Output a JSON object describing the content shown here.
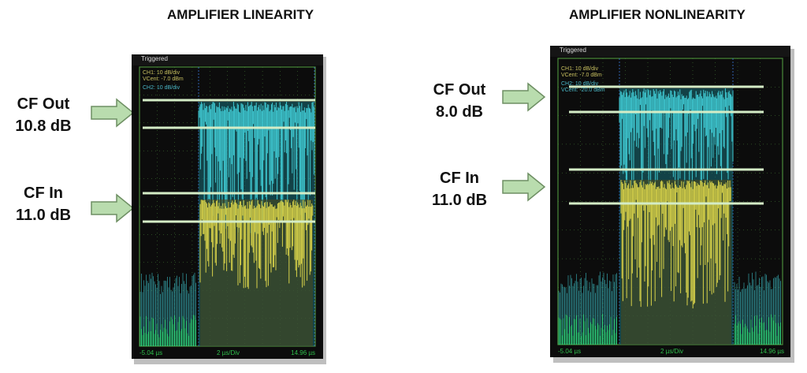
{
  "left": {
    "title": "AMPLIFIER LINEARITY",
    "cf_out": {
      "label": "CF Out",
      "value": "10.8 dB"
    },
    "cf_in": {
      "label": "CF In",
      "value": "11.0 dB"
    },
    "scope": {
      "status": "Triggered",
      "ch1": "CH1: 10 dB/div",
      "ch1_vcent": "VCent: -7.0 dBm",
      "ch2": "CH2: 10 dB/div",
      "x_start": "-5.04 µs",
      "x_scale": "2 µs/Div",
      "x_end": "14.96 µs"
    }
  },
  "right": {
    "title": "AMPLIFIER NONLINEARITY",
    "cf_out": {
      "label": "CF Out",
      "value": "8.0 dB"
    },
    "cf_in": {
      "label": "CF In",
      "value": "11.0 dB"
    },
    "scope": {
      "status": "Triggered",
      "ch1": "CH1: 10 dB/div",
      "ch1_vcent": "VCent: -7.0 dBm",
      "ch2": "CH2: 10 dB/div",
      "ch2_vcent": "VCent: -20.0 dBm",
      "x_start": "-5.04 µs",
      "x_scale": "2 µs/Div",
      "x_end": "14.96 µs"
    }
  },
  "colors": {
    "arrow_fill": "#b9dcae",
    "arrow_stroke": "#6e8f63",
    "trace_cyan": "#3fc9d2",
    "trace_yellow": "#d8d24a",
    "trace_green": "#2edc7a",
    "marker_line": "#d4ecc6",
    "grid": "#4a8a3a"
  }
}
